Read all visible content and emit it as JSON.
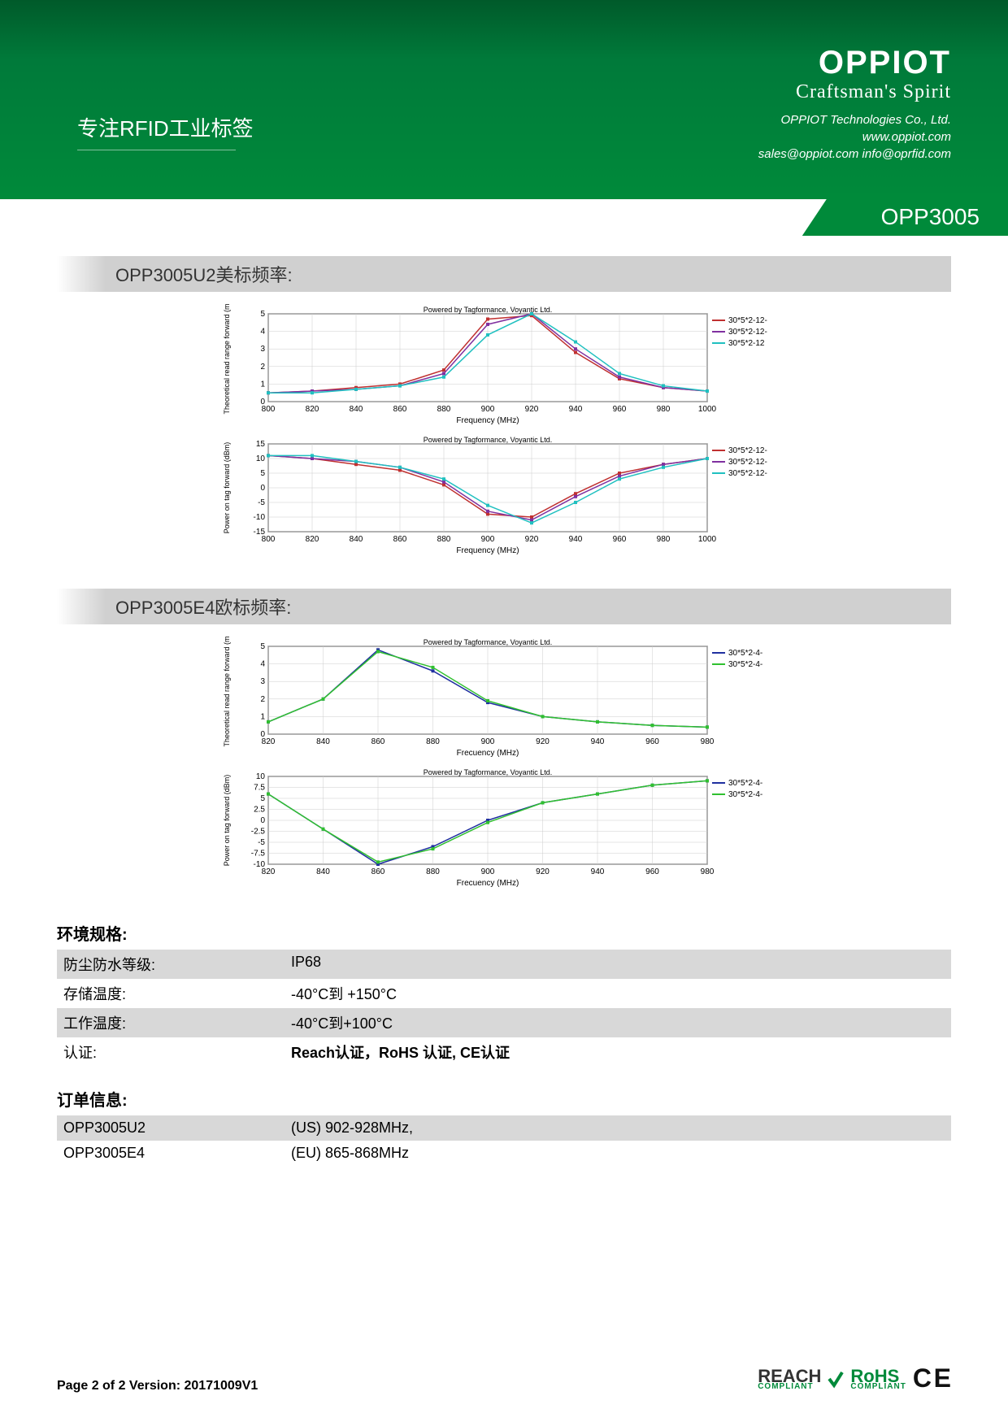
{
  "header": {
    "logo": "OPPIOT",
    "tagline": "Craftsman's Spirit",
    "company": "OPPIOT Technologies Co., Ltd.",
    "website": "www.oppiot.com",
    "emails": "sales@oppiot.com  info@oprfid.com",
    "focus": "专注RFID工业标签"
  },
  "product": "OPP3005",
  "sections": {
    "u2_title": "OPP3005U2美标频率:",
    "e4_title": "OPP3005E4欧标频率:"
  },
  "chart_data": [
    {
      "type": "line",
      "title": "Powered by Tagformance, Voyantic Ltd.",
      "xlabel": "Frequency (MHz)",
      "ylabel": "Theoretical read range forward (m)",
      "xlim": [
        800,
        1000
      ],
      "ylim": [
        0,
        5
      ],
      "xticks": [
        800,
        820,
        840,
        860,
        880,
        900,
        920,
        940,
        960,
        980,
        1000
      ],
      "yticks": [
        0,
        1,
        2,
        3,
        4,
        5
      ],
      "series": [
        {
          "name": "30*5*2-12-",
          "color": "#c03030",
          "x": [
            800,
            820,
            840,
            860,
            880,
            900,
            920,
            940,
            960,
            980,
            1000
          ],
          "values": [
            0.5,
            0.6,
            0.8,
            1.0,
            1.8,
            4.7,
            4.9,
            2.8,
            1.3,
            0.8,
            0.6
          ]
        },
        {
          "name": "30*5*2-12-",
          "color": "#8030a0",
          "x": [
            800,
            820,
            840,
            860,
            880,
            900,
            920,
            940,
            960,
            980,
            1000
          ],
          "values": [
            0.5,
            0.6,
            0.7,
            0.9,
            1.6,
            4.4,
            5.0,
            3.0,
            1.4,
            0.8,
            0.6
          ]
        },
        {
          "name": "30*5*2-12",
          "color": "#20c0c0",
          "x": [
            800,
            820,
            840,
            860,
            880,
            900,
            920,
            940,
            960,
            980,
            1000
          ],
          "values": [
            0.5,
            0.5,
            0.7,
            0.9,
            1.4,
            3.8,
            5.0,
            3.4,
            1.6,
            0.9,
            0.6
          ]
        }
      ]
    },
    {
      "type": "line",
      "title": "Powered by Tagformance, Voyantic Ltd.",
      "xlabel": "Frequency (MHz)",
      "ylabel": "Power on tag forward (dBm)",
      "xlim": [
        800,
        1000
      ],
      "ylim": [
        -15,
        15
      ],
      "xticks": [
        800,
        820,
        840,
        860,
        880,
        900,
        920,
        940,
        960,
        980,
        1000
      ],
      "yticks": [
        -15,
        -10,
        -5,
        0,
        5,
        10,
        15
      ],
      "series": [
        {
          "name": "30*5*2-12-",
          "color": "#c03030",
          "x": [
            800,
            820,
            840,
            860,
            880,
            900,
            920,
            940,
            960,
            980,
            1000
          ],
          "values": [
            11,
            10,
            8,
            6,
            1,
            -9,
            -10,
            -2,
            5,
            8,
            10
          ]
        },
        {
          "name": "30*5*2-12-",
          "color": "#8030a0",
          "x": [
            800,
            820,
            840,
            860,
            880,
            900,
            920,
            940,
            960,
            980,
            1000
          ],
          "values": [
            11,
            10,
            9,
            7,
            2,
            -8,
            -11,
            -3,
            4,
            8,
            10
          ]
        },
        {
          "name": "30*5*2-12-",
          "color": "#20c0c0",
          "x": [
            800,
            820,
            840,
            860,
            880,
            900,
            920,
            940,
            960,
            980,
            1000
          ],
          "values": [
            11,
            11,
            9,
            7,
            3,
            -6,
            -12,
            -5,
            3,
            7,
            10
          ]
        }
      ]
    },
    {
      "type": "line",
      "title": "Powered by Tagformance, Voyantic Ltd.",
      "xlabel": "Frecuency (MHz)",
      "ylabel": "Theoretical read range forward (m)",
      "xlim": [
        820,
        980
      ],
      "ylim": [
        0,
        5
      ],
      "xticks": [
        820,
        840,
        860,
        880,
        900,
        920,
        940,
        960,
        980
      ],
      "yticks": [
        0,
        1,
        2,
        3,
        4,
        5
      ],
      "series": [
        {
          "name": "30*5*2-4-",
          "color": "#2030a0",
          "x": [
            820,
            840,
            860,
            880,
            900,
            920,
            940,
            960,
            980
          ],
          "values": [
            0.7,
            2.0,
            4.8,
            3.6,
            1.8,
            1.0,
            0.7,
            0.5,
            0.4
          ]
        },
        {
          "name": "30*5*2-4-",
          "color": "#30c030",
          "x": [
            820,
            840,
            860,
            880,
            900,
            920,
            940,
            960,
            980
          ],
          "values": [
            0.7,
            2.0,
            4.7,
            3.8,
            1.9,
            1.0,
            0.7,
            0.5,
            0.4
          ]
        }
      ]
    },
    {
      "type": "line",
      "title": "Powered by Tagformance, Voyantic Ltd.",
      "xlabel": "Frecuency (MHz)",
      "ylabel": "Power on tag forward (dBm)",
      "xlim": [
        820,
        980
      ],
      "ylim": [
        -10,
        10
      ],
      "xticks": [
        820,
        840,
        860,
        880,
        900,
        920,
        940,
        960,
        980
      ],
      "yticks": [
        -10,
        -7.5,
        -5,
        -2.5,
        0,
        2.5,
        5,
        7.5,
        10
      ],
      "series": [
        {
          "name": "30*5*2-4-",
          "color": "#2030a0",
          "x": [
            820,
            840,
            860,
            880,
            900,
            920,
            940,
            960,
            980
          ],
          "values": [
            6,
            -2,
            -10,
            -6,
            0,
            4,
            6,
            8,
            9
          ]
        },
        {
          "name": "30*5*2-4-",
          "color": "#30c030",
          "x": [
            820,
            840,
            860,
            880,
            900,
            920,
            940,
            960,
            980
          ],
          "values": [
            6,
            -2,
            -9.5,
            -6.5,
            -0.5,
            4,
            6,
            8,
            9
          ]
        }
      ]
    }
  ],
  "env": {
    "title": "环境规格:",
    "rows": [
      {
        "label": "防尘防水等级:",
        "value": "IP68",
        "shaded": true
      },
      {
        "label": "存储温度:",
        "value": "-40°C到 +150°C",
        "shaded": false
      },
      {
        "label": "工作温度:",
        "value": "-40°C到+100°C",
        "shaded": true
      },
      {
        "label": "认证:",
        "value": "Reach认证，RoHS 认证, CE认证",
        "shaded": false,
        "bold": true
      }
    ]
  },
  "order": {
    "title": "订单信息:",
    "rows": [
      {
        "label": "OPP3005U2",
        "value": "(US) 902-928MHz,",
        "shaded": true
      },
      {
        "label": "OPP3005E4",
        "value": "(EU) 865-868MHz",
        "shaded": false
      }
    ]
  },
  "footer": {
    "page": "Page 2 of 2  Version: 20171009V1",
    "badges": [
      "REACH",
      "RoHS",
      "CE"
    ]
  }
}
